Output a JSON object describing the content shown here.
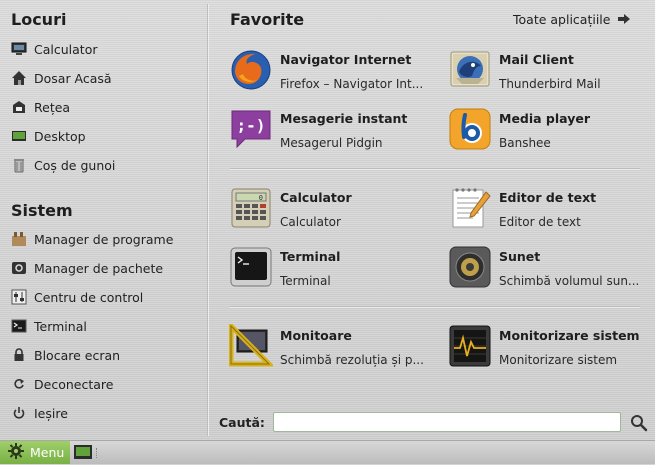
{
  "places": {
    "title": "Locuri",
    "items": [
      {
        "label": "Calculator",
        "icon": "computer-icon"
      },
      {
        "label": "Dosar Acasă",
        "icon": "home-icon"
      },
      {
        "label": "Rețea",
        "icon": "network-icon"
      },
      {
        "label": "Desktop",
        "icon": "desktop-icon"
      },
      {
        "label": "Coș de gunoi",
        "icon": "trash-icon"
      }
    ]
  },
  "system": {
    "title": "Sistem",
    "items": [
      {
        "label": "Manager de programe",
        "icon": "software-manager-icon"
      },
      {
        "label": "Manager de pachete",
        "icon": "package-manager-icon"
      },
      {
        "label": "Centru de control",
        "icon": "control-center-icon"
      },
      {
        "label": "Terminal",
        "icon": "terminal-icon"
      },
      {
        "label": "Blocare ecran",
        "icon": "lock-icon"
      },
      {
        "label": "Deconectare",
        "icon": "logout-icon"
      },
      {
        "label": "Ieșire",
        "icon": "power-icon"
      }
    ]
  },
  "favorites": {
    "title": "Favorite",
    "all_apps_label": "Toate aplicațiile",
    "apps": [
      {
        "name": "Navigator Internet",
        "desc": "Firefox – Navigator Int...",
        "icon": "firefox-icon"
      },
      {
        "name": "Mail Client",
        "desc": "Thunderbird Mail",
        "icon": "thunderbird-icon"
      },
      {
        "name": "Mesagerie instant",
        "desc": "Mesagerul Pidgin",
        "icon": "pidgin-icon"
      },
      {
        "name": "Media player",
        "desc": "Banshee",
        "icon": "banshee-icon"
      },
      {
        "name": "Calculator",
        "desc": "Calculator",
        "icon": "calculator-icon"
      },
      {
        "name": "Editor de text",
        "desc": "Editor de text",
        "icon": "text-editor-icon"
      },
      {
        "name": "Terminal",
        "desc": "Terminal",
        "icon": "terminal-app-icon"
      },
      {
        "name": "Sunet",
        "desc": "Schimbă volumul sun...",
        "icon": "sound-icon"
      },
      {
        "name": "Monitoare",
        "desc": "Schimbă rezoluția și p...",
        "icon": "display-icon"
      },
      {
        "name": "Monitorizare sistem",
        "desc": "Monitorizare sistem",
        "icon": "system-monitor-icon"
      }
    ]
  },
  "search": {
    "label": "Caută:",
    "value": ""
  },
  "panel": {
    "menu_label": "Menu"
  },
  "colors": {
    "accent": "#87bd55"
  }
}
